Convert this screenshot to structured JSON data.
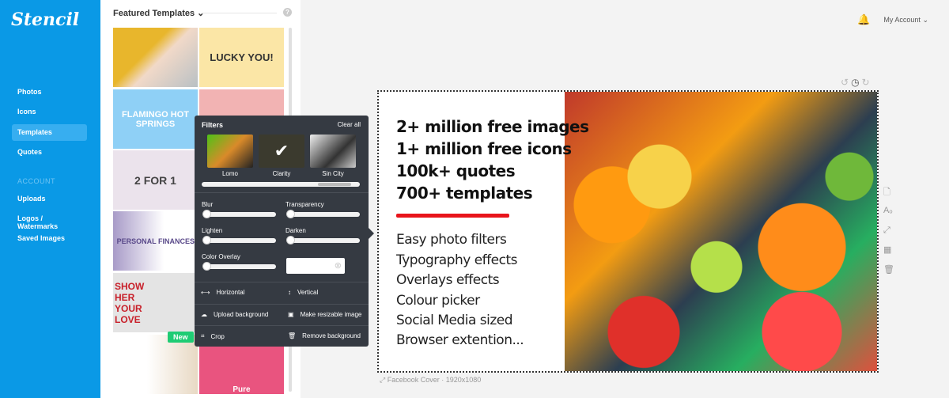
{
  "brand": "Stencil",
  "sidebar": {
    "items": [
      {
        "label": "Photos"
      },
      {
        "label": "Icons"
      },
      {
        "label": "Templates",
        "active": true
      },
      {
        "label": "Quotes"
      }
    ],
    "section": "ACCOUNT",
    "account_items": [
      {
        "label": "Uploads"
      },
      {
        "label": "Logos / Watermarks"
      },
      {
        "label": "Saved Images"
      }
    ]
  },
  "panel": {
    "title": "Featured Templates",
    "help": "?",
    "badge_new": "New",
    "templates": [
      {
        "text": ""
      },
      {
        "text": "LUCKY YOU!"
      },
      {
        "text": "FLAMINGO HOT SPRINGS"
      },
      {
        "text": ""
      },
      {
        "text": "2 FOR 1"
      },
      {
        "text": ""
      },
      {
        "text": "PERSONAL FINANCES"
      },
      {
        "text": ""
      },
      {
        "text": "SHOW HER YOUR LOVE"
      },
      {
        "text": ""
      },
      {
        "text": ""
      },
      {
        "text": "Pure"
      }
    ]
  },
  "filters": {
    "title": "Filters",
    "clear": "Clear all",
    "presets": [
      {
        "label": "Lomo"
      },
      {
        "label": "Clarity",
        "selected": true
      },
      {
        "label": "Sin City"
      }
    ],
    "sliders": {
      "blur": "Blur",
      "transparency": "Transparency",
      "lighten": "Lighten",
      "darken": "Darken",
      "color_overlay": "Color Overlay"
    },
    "actions": {
      "horizontal": "Horizontal",
      "vertical": "Vertical",
      "upload_bg": "Upload background",
      "resizable": "Make resizable image",
      "crop": "Crop",
      "remove_bg": "Remove background"
    }
  },
  "header": {
    "account": "My Account"
  },
  "canvas": {
    "headlines": [
      "2+ million free images",
      "1+ million free icons",
      "100k+ quotes",
      "700+ templates"
    ],
    "features": [
      "Easy photo filters",
      "Typography effects",
      "Overlays effects",
      "Colour picker",
      "Social Media sized",
      "Browser extention..."
    ],
    "caption": "Facebook Cover · 1920x1080",
    "accent": "#e8141b"
  },
  "colors": {
    "brand": "#0a99e6",
    "popup": "#353a42",
    "new_badge": "#1fcc74"
  }
}
